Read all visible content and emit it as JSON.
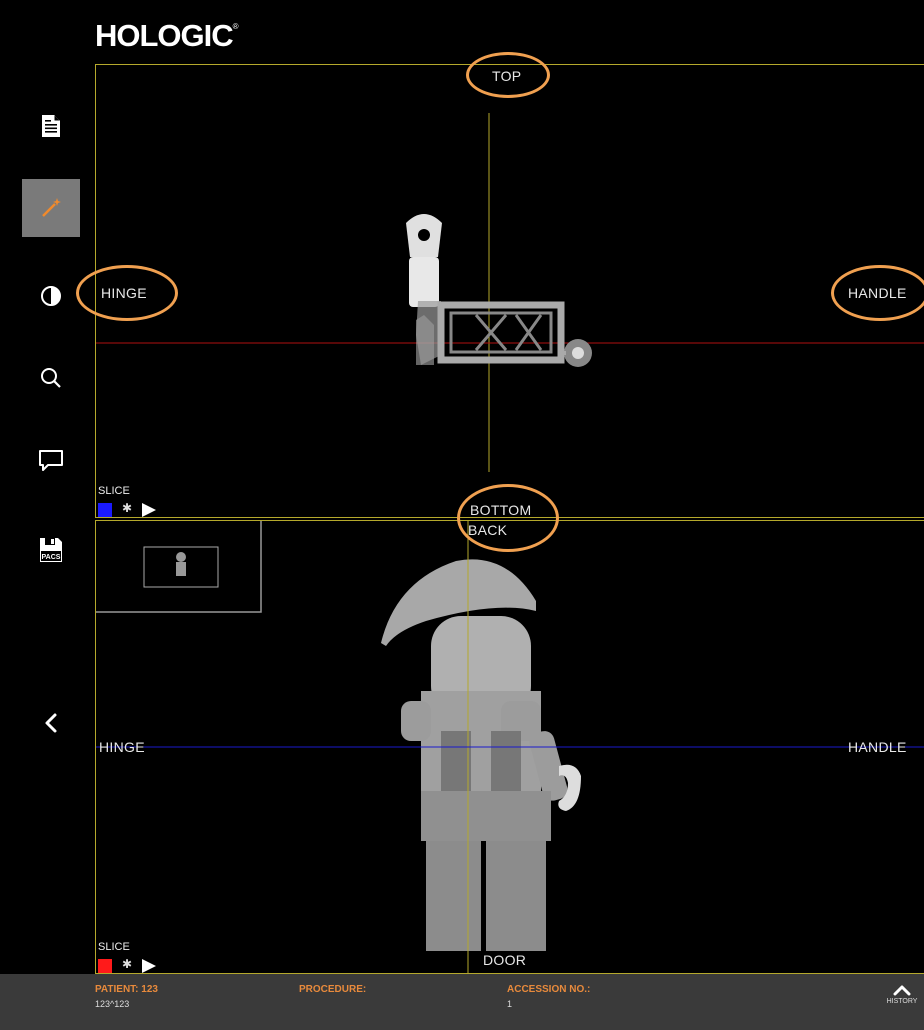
{
  "brand": {
    "logo_text": "HOLOGIC",
    "registered": "®"
  },
  "sidebar": {
    "tools": [
      {
        "name": "report",
        "icon": "document-icon"
      },
      {
        "name": "wand",
        "icon": "magic-wand-icon",
        "active": true
      },
      {
        "name": "contrast",
        "icon": "contrast-icon"
      },
      {
        "name": "zoom",
        "icon": "search-icon"
      },
      {
        "name": "annotate",
        "icon": "comment-icon"
      },
      {
        "name": "pacs",
        "icon": "pacs-save-icon",
        "label": "PACS"
      },
      {
        "name": "collapse",
        "icon": "chevron-left-icon"
      }
    ]
  },
  "viewport_top": {
    "labels": {
      "top": "TOP",
      "left": "HINGE",
      "right": "HANDLE",
      "bottom": "BOTTOM"
    },
    "slice_label": "SLICE",
    "slice_color": "#1a1aff"
  },
  "viewport_bottom": {
    "labels": {
      "top": "BACK",
      "left": "HINGE",
      "right": "HANDLE",
      "bottom": "DOOR"
    },
    "slice_label": "SLICE",
    "slice_color": "#ff1a1a"
  },
  "accent_colors": {
    "annotation_circle": "#f0a050",
    "frame": "#b5a92c",
    "footer_label": "#e88a3c"
  },
  "footer": {
    "patient_label": "PATIENT: 123",
    "patient_value": "123^123",
    "procedure_label": "PROCEDURE:",
    "procedure_value": "",
    "accession_label": "ACCESSION NO.:",
    "accession_value": "1",
    "history_label": "HISTORY"
  }
}
